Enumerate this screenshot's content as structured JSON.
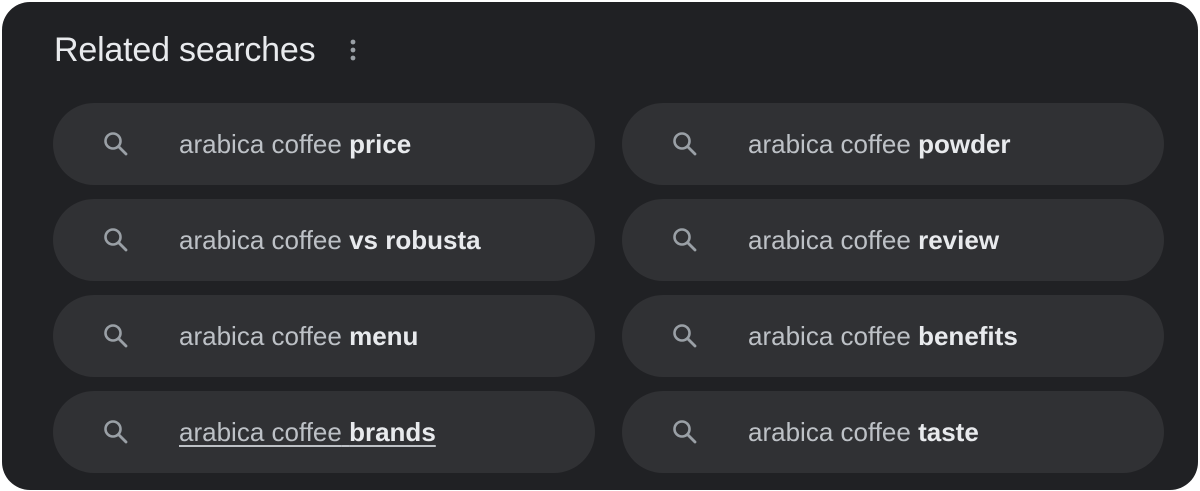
{
  "header": {
    "title": "Related searches"
  },
  "colors": {
    "panel_bg": "#202124",
    "chip_bg": "#303134",
    "text_primary": "#e8eaed",
    "text_secondary": "#bdc1c6",
    "icon": "#9aa0a6"
  },
  "icons": {
    "more": "more-vert-icon",
    "search": "search-icon"
  },
  "related": [
    {
      "prefix": "arabica coffee",
      "bold": "price",
      "underlined": false
    },
    {
      "prefix": "arabica coffee",
      "bold": "powder",
      "underlined": false
    },
    {
      "prefix": "arabica coffee",
      "bold": "vs robusta",
      "underlined": false
    },
    {
      "prefix": "arabica coffee",
      "bold": "review",
      "underlined": false
    },
    {
      "prefix": "arabica coffee",
      "bold": "menu",
      "underlined": false
    },
    {
      "prefix": "arabica coffee",
      "bold": "benefits",
      "underlined": false
    },
    {
      "prefix": "arabica coffee",
      "bold": "brands",
      "underlined": true
    },
    {
      "prefix": "arabica coffee",
      "bold": "taste",
      "underlined": false
    }
  ]
}
